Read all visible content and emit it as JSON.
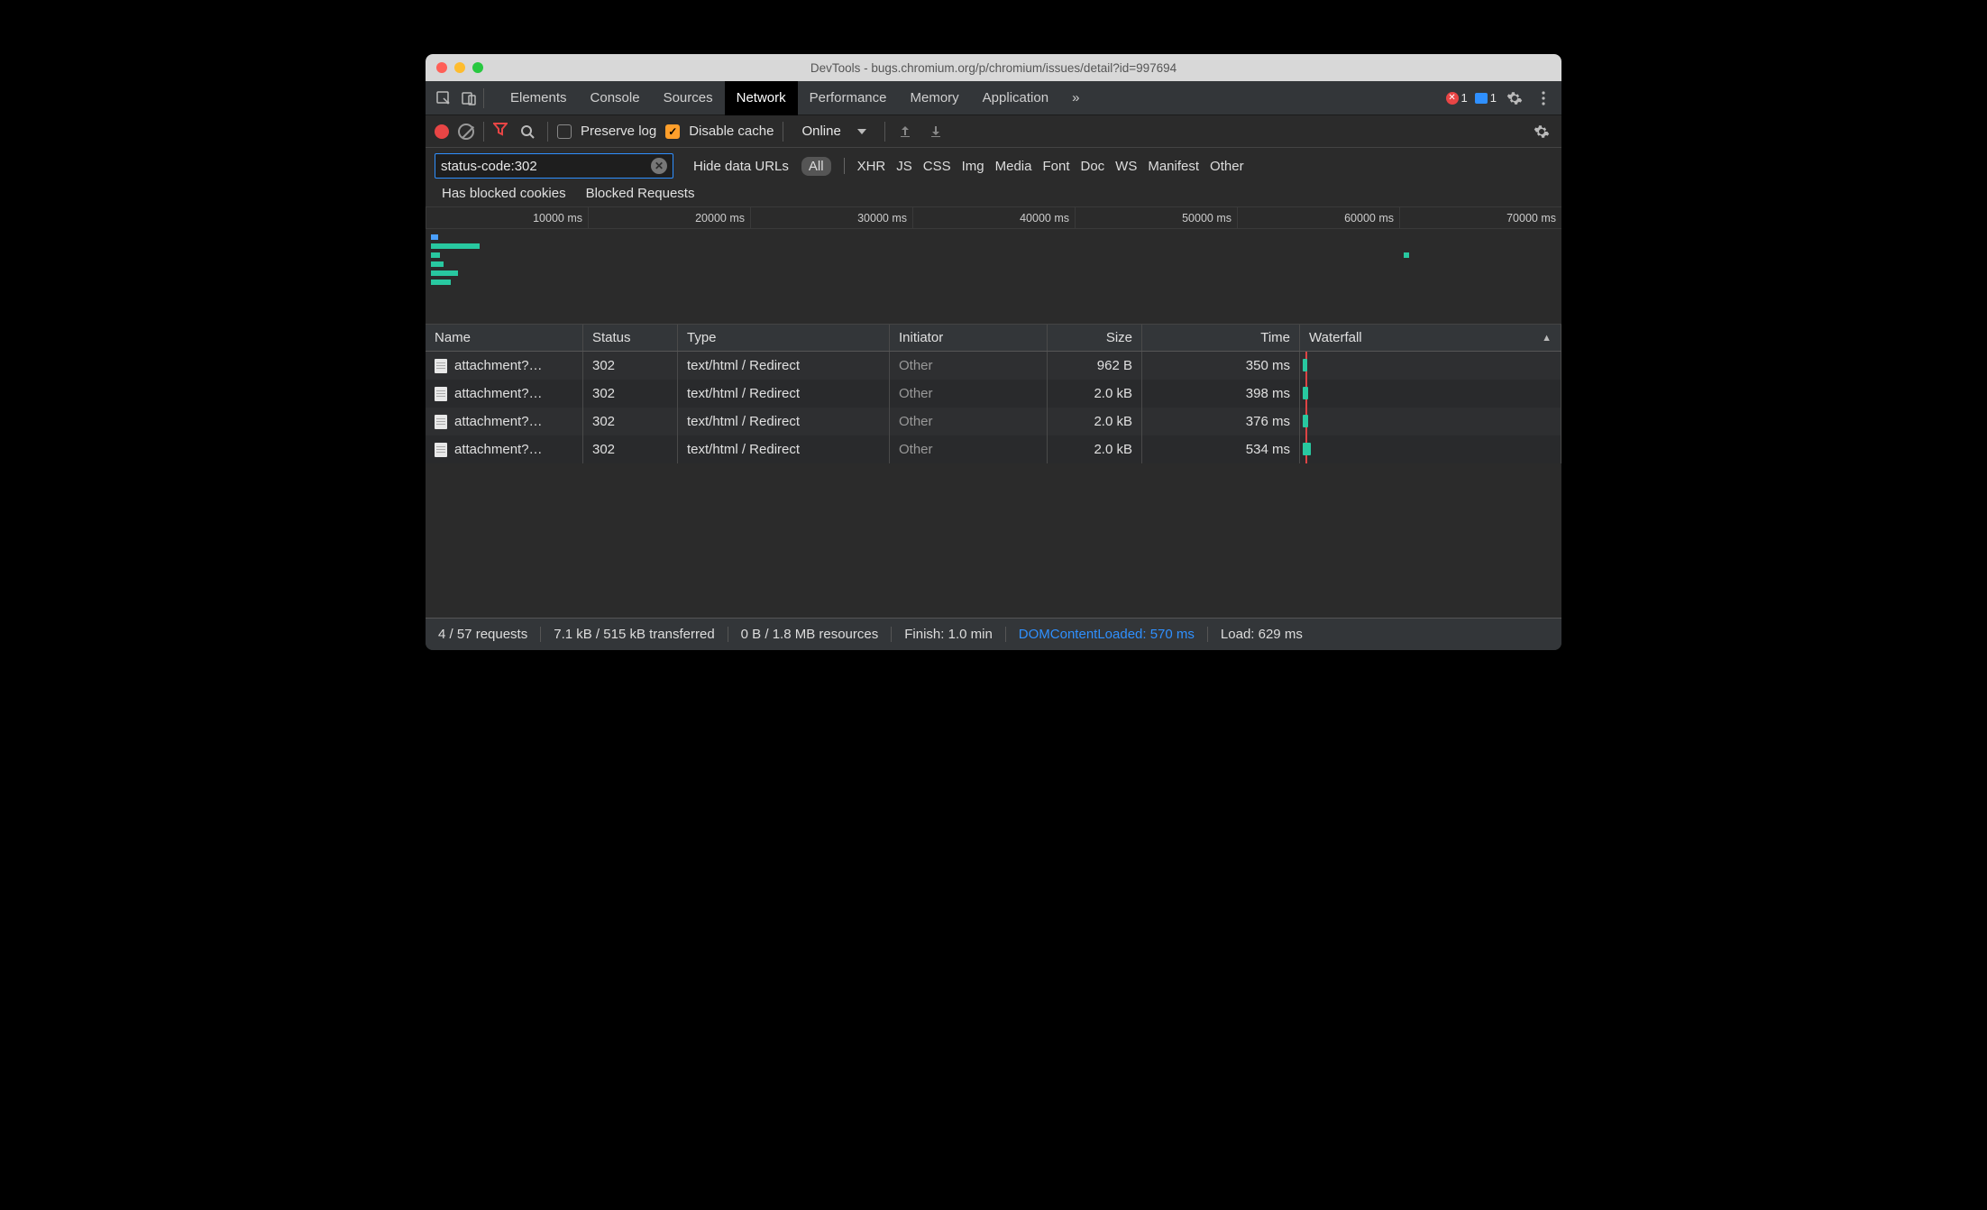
{
  "window": {
    "title": "DevTools - bugs.chromium.org/p/chromium/issues/detail?id=997694"
  },
  "tabs": {
    "items": [
      "Elements",
      "Console",
      "Sources",
      "Network",
      "Performance",
      "Memory",
      "Application"
    ],
    "active": "Network",
    "overflow_glyph": "»",
    "error_count": "1",
    "info_count": "1"
  },
  "toolbar": {
    "preserve_log_label": "Preserve log",
    "preserve_log_checked": false,
    "disable_cache_label": "Disable cache",
    "disable_cache_checked": true,
    "throttling_value": "Online"
  },
  "filters": {
    "input_value": "status-code:302",
    "hide_data_urls_label": "Hide data URLs",
    "type_all": "All",
    "types": [
      "XHR",
      "JS",
      "CSS",
      "Img",
      "Media",
      "Font",
      "Doc",
      "WS",
      "Manifest",
      "Other"
    ],
    "has_blocked_cookies_label": "Has blocked cookies",
    "blocked_requests_label": "Blocked Requests"
  },
  "timeline": {
    "ticks": [
      "10000 ms",
      "20000 ms",
      "30000 ms",
      "40000 ms",
      "50000 ms",
      "60000 ms",
      "70000 ms"
    ]
  },
  "table": {
    "columns": {
      "name": "Name",
      "status": "Status",
      "type": "Type",
      "initiator": "Initiator",
      "size": "Size",
      "time": "Time",
      "waterfall": "Waterfall"
    },
    "rows": [
      {
        "name": "attachment?…",
        "status": "302",
        "type": "text/html / Redirect",
        "initiator": "Other",
        "size": "962 B",
        "time": "350 ms"
      },
      {
        "name": "attachment?…",
        "status": "302",
        "type": "text/html / Redirect",
        "initiator": "Other",
        "size": "2.0 kB",
        "time": "398 ms"
      },
      {
        "name": "attachment?…",
        "status": "302",
        "type": "text/html / Redirect",
        "initiator": "Other",
        "size": "2.0 kB",
        "time": "376 ms"
      },
      {
        "name": "attachment?…",
        "status": "302",
        "type": "text/html / Redirect",
        "initiator": "Other",
        "size": "2.0 kB",
        "time": "534 ms"
      }
    ]
  },
  "status": {
    "requests": "4 / 57 requests",
    "transferred": "7.1 kB / 515 kB transferred",
    "resources": "0 B / 1.8 MB resources",
    "finish": "Finish: 1.0 min",
    "dcl": "DOMContentLoaded: 570 ms",
    "load": "Load: 629 ms"
  }
}
